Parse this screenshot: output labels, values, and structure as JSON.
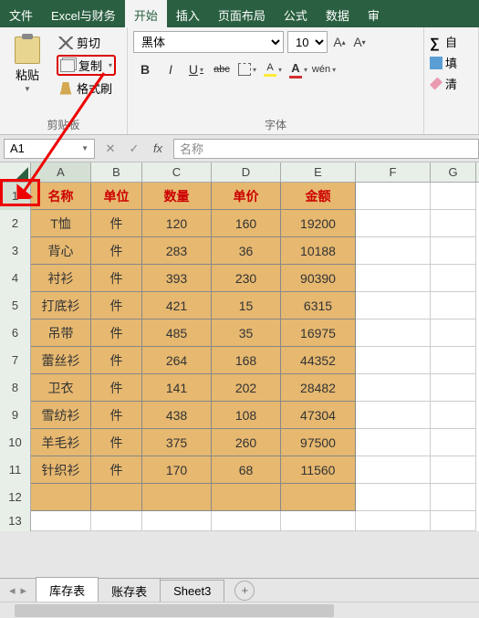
{
  "menu": {
    "items": [
      "文件",
      "Excel与财务",
      "开始",
      "插入",
      "页面布局",
      "公式",
      "数据",
      "审"
    ],
    "activeIndex": 2
  },
  "ribbon": {
    "clipboard": {
      "paste": "粘贴",
      "cut": "剪切",
      "copy": "复制",
      "brush": "格式刷",
      "label": "剪贴板"
    },
    "font": {
      "name": "黑体",
      "size": "10",
      "bold": "B",
      "italic": "I",
      "underline": "U",
      "strike": "abc",
      "label": "字体",
      "wen": "wén"
    },
    "edit": {
      "sum": "自",
      "fill": "填",
      "clear": "清"
    }
  },
  "formula": {
    "cellref": "A1",
    "value": "名称",
    "fx": "fx"
  },
  "cols": [
    "A",
    "B",
    "C",
    "D",
    "E",
    "F",
    "G"
  ],
  "headers": [
    "名称",
    "单位",
    "数量",
    "单价",
    "金额"
  ],
  "rows": [
    [
      "T恤",
      "件",
      "120",
      "160",
      "19200"
    ],
    [
      "背心",
      "件",
      "283",
      "36",
      "10188"
    ],
    [
      "衬衫",
      "件",
      "393",
      "230",
      "90390"
    ],
    [
      "打底衫",
      "件",
      "421",
      "15",
      "6315"
    ],
    [
      "吊带",
      "件",
      "485",
      "35",
      "16975"
    ],
    [
      "蕾丝衫",
      "件",
      "264",
      "168",
      "44352"
    ],
    [
      "卫衣",
      "件",
      "141",
      "202",
      "28482"
    ],
    [
      "雪纺衫",
      "件",
      "438",
      "108",
      "47304"
    ],
    [
      "羊毛衫",
      "件",
      "375",
      "260",
      "97500"
    ],
    [
      "针织衫",
      "件",
      "170",
      "68",
      "11560"
    ]
  ],
  "tabs": {
    "items": [
      "库存表",
      "账存表",
      "Sheet3"
    ],
    "activeIndex": 0
  }
}
